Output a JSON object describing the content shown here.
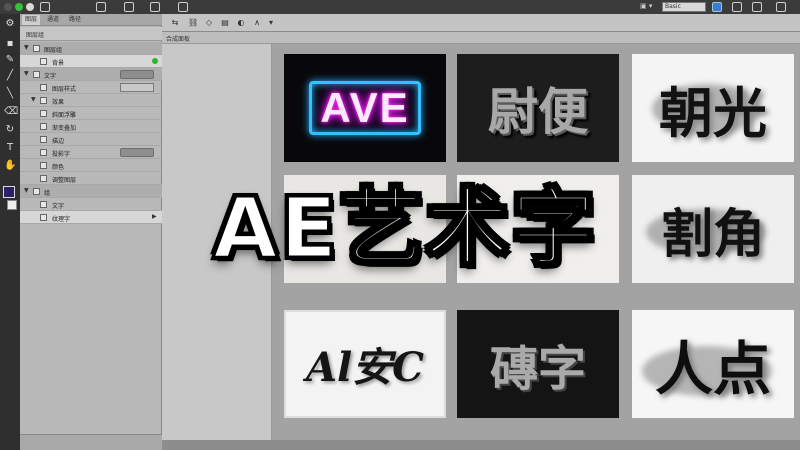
{
  "topbar": {
    "workspace_value": "Basic"
  },
  "layers_panel": {
    "tabs": [
      "图层",
      "通道",
      "路径"
    ],
    "sub_label": "图层组",
    "rows": [
      {
        "label": "图层组"
      },
      {
        "label": "背景"
      },
      {
        "label": "文字"
      },
      {
        "label": "图层样式"
      },
      {
        "label": "效果"
      },
      {
        "label": "斜面浮雕"
      },
      {
        "label": "渐变叠加"
      },
      {
        "label": "描边"
      },
      {
        "label": "投影字"
      },
      {
        "label": "颜色"
      },
      {
        "label": "调整图层"
      },
      {
        "label": "组"
      },
      {
        "label": "文字"
      },
      {
        "label": "纹理字"
      }
    ]
  },
  "canvas": {
    "subbar_label": "合成面板"
  },
  "thumbnails": [
    {
      "name": "neon",
      "text": "AVE"
    },
    {
      "name": "metal",
      "text": "尉便"
    },
    {
      "name": "ink1",
      "text": "朝光"
    },
    {
      "name": "ink2",
      "text": "割角"
    },
    {
      "name": "brush",
      "text": "Al安C"
    },
    {
      "name": "stone",
      "text": "磚字"
    },
    {
      "name": "ink3",
      "text": "人点"
    }
  ],
  "overlay": {
    "title": "AE艺术字"
  },
  "colors": {
    "accent_blue": "#35c0ff",
    "neon_pink": "#ff1adb",
    "active_green": "#2bb52b"
  }
}
